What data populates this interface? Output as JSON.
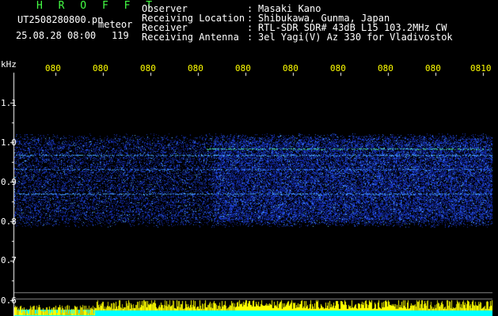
{
  "header": {
    "logo": "H R O F F T",
    "filename": "UT2508280800.pn",
    "mode": "meteor",
    "datetime": "25.08.28 08:00",
    "count": "119",
    "fields": [
      {
        "label": "Observer",
        "value": "Masaki Kano"
      },
      {
        "label": "Receiving Location",
        "value": "Shibukawa, Gunma, Japan"
      },
      {
        "label": "Receiver",
        "value": "RTL-SDR SDR# 43dB L15 103.2MHz CW"
      },
      {
        "label": "Receiving Antenna",
        "value": "3el Yagi(V) Az 330 for Vladivostok"
      }
    ]
  },
  "axis": {
    "unit": "kHz",
    "y_ticks": [
      "1.1",
      "1.0",
      "0.9",
      "0.8",
      "0.7",
      "0.6"
    ],
    "x_ticks": [
      "080",
      "080",
      "080",
      "080",
      "080",
      "080",
      "080",
      "080",
      "080",
      "0810"
    ]
  },
  "colors": {
    "background": "#000000",
    "header_text": "#ffffff",
    "logo": "#44ff44",
    "time_ticks": "#ffff00",
    "bottom_bar": "#00ffff"
  }
}
